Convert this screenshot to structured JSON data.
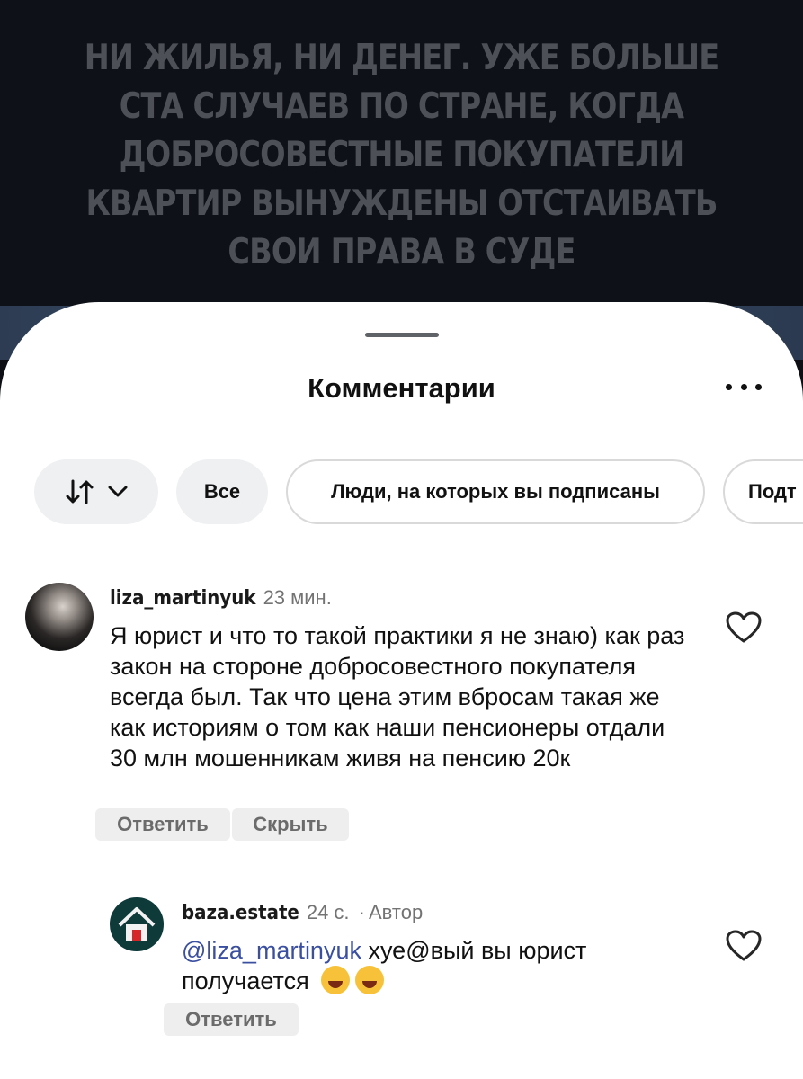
{
  "story": {
    "caption": "Ни жилья, ни денег. Уже больше ста случаев по стране, когда добросовестные покупатели квартир вынуждены отстаивать свои права в суде"
  },
  "sheet": {
    "title": "Комментарии",
    "more_icon": "more-horizontal-icon"
  },
  "filters": {
    "sort_icon": "sort-arrows-icon",
    "chevron_icon": "chevron-down-icon",
    "chips": [
      {
        "label": "Все"
      },
      {
        "label": "Люди, на которых вы подписаны"
      },
      {
        "label": "Подт"
      }
    ]
  },
  "comments": [
    {
      "username": "liza_martinyuk",
      "time": "23 мин.",
      "text": "Я юрист и что то такой практики я не знаю) как раз закон на стороне добросовестного покупателя всегда был. Так что цена этим вбросам такая же как историям о том как наши пенсионеры отдали 30 млн мошенникам живя на пенсию 20к",
      "actions": {
        "reply": "Ответить",
        "hide": "Скрыть"
      },
      "like_icon": "heart-outline-icon"
    }
  ],
  "reply": {
    "username": "baza.estate",
    "time": "24 с.",
    "separator": "·",
    "author_tag": "Автор",
    "mention": "@liza_martinyuk",
    "text": "хуе@вый вы юрист получается",
    "emojis": [
      "rolling-on-floor-laughing-emoji",
      "tears-of-joy-emoji"
    ],
    "actions": {
      "reply": "Ответить"
    },
    "like_icon": "heart-outline-icon"
  },
  "colors": {
    "mention": "#3b4fa0",
    "meta": "#737373",
    "chip_fill": "#eff0f2"
  }
}
